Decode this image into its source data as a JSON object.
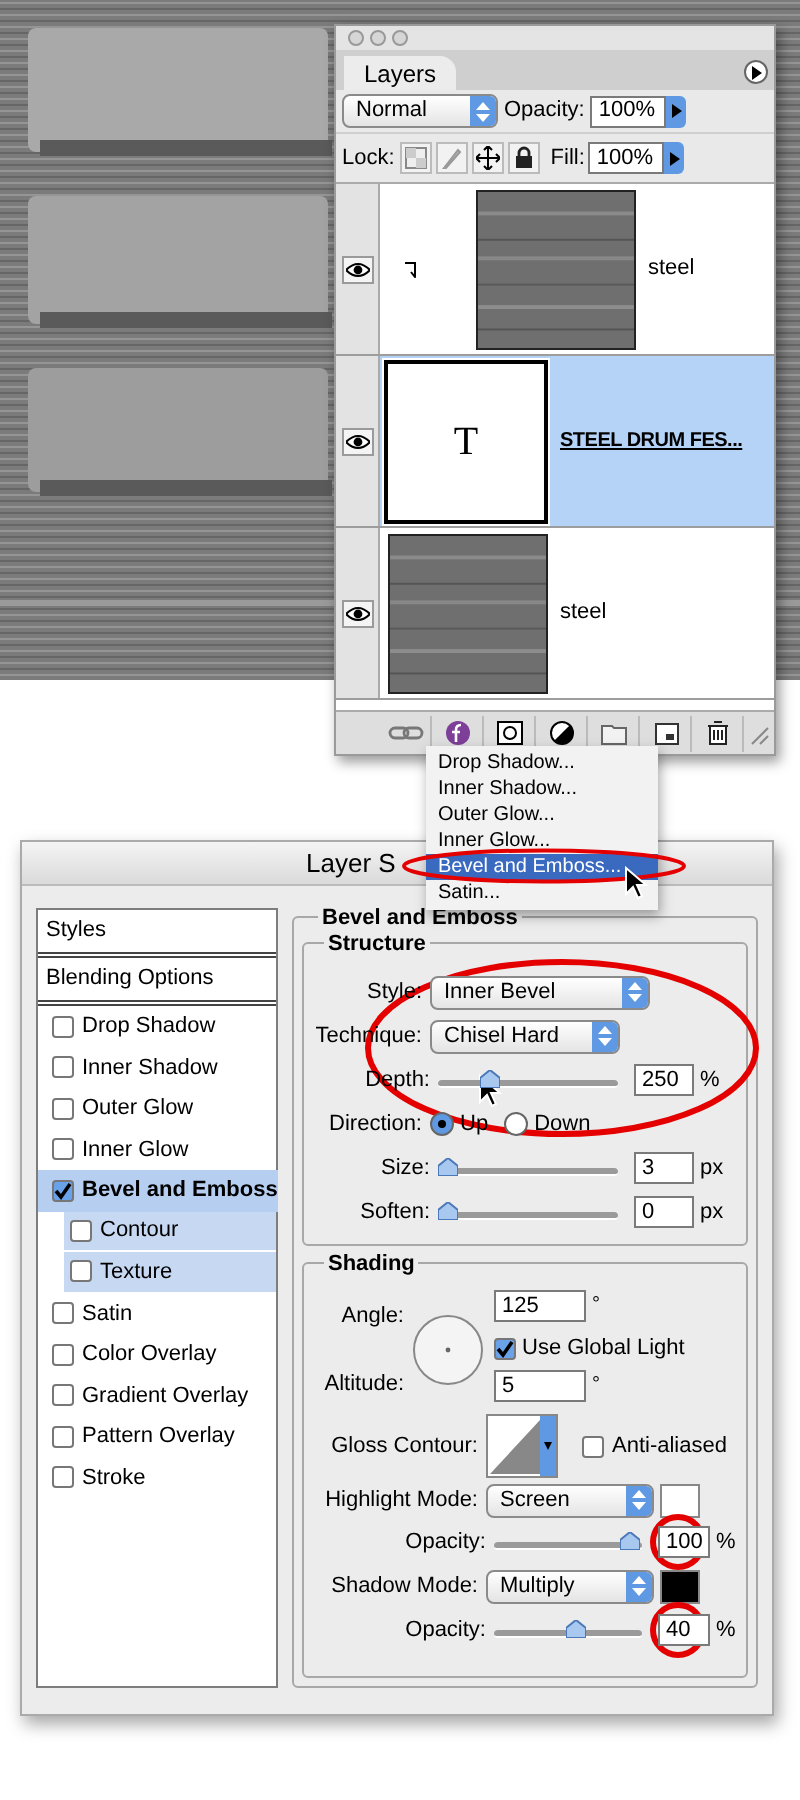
{
  "layers_panel": {
    "tab": "Layers",
    "blend_mode": "Normal",
    "opacity_label": "Opacity:",
    "opacity": "100%",
    "lock_label": "Lock:",
    "fill_label": "Fill:",
    "fill": "100%",
    "layers": [
      {
        "name": "steel",
        "visible": true,
        "clipped": true,
        "selected": false
      },
      {
        "name": "STEEL DRUM FES...",
        "kind": "text",
        "thumb_letter": "T",
        "visible": true,
        "clipped": false,
        "selected": true
      },
      {
        "name": "steel",
        "visible": true,
        "clipped": false,
        "selected": false
      }
    ]
  },
  "effects_menu": {
    "items": [
      {
        "label": "Drop Shadow...",
        "selected": false
      },
      {
        "label": "Inner Shadow...",
        "selected": false
      },
      {
        "label": "Outer Glow...",
        "selected": false
      },
      {
        "label": "Inner Glow...",
        "selected": false
      },
      {
        "label": "Bevel and Emboss...",
        "selected": true
      },
      {
        "label": "Satin...",
        "selected": false
      }
    ]
  },
  "layer_style": {
    "title": "Layer S",
    "styles_list": [
      {
        "label": "Styles",
        "kind": "header"
      },
      {
        "label": "Blending Options",
        "kind": "header"
      },
      {
        "label": "Drop Shadow",
        "kind": "effect",
        "checked": false,
        "selected": false
      },
      {
        "label": "Inner Shadow",
        "kind": "effect",
        "checked": false,
        "selected": false
      },
      {
        "label": "Outer Glow",
        "kind": "effect",
        "checked": false,
        "selected": false
      },
      {
        "label": "Inner Glow",
        "kind": "effect",
        "checked": false,
        "selected": false
      },
      {
        "label": "Bevel and Emboss",
        "kind": "effect",
        "checked": true,
        "selected": true,
        "children": [
          {
            "label": "Contour",
            "kind": "effect",
            "checked": false,
            "selected": true
          },
          {
            "label": "Texture",
            "kind": "effect",
            "checked": false,
            "selected": true
          }
        ]
      },
      {
        "label": "Satin",
        "kind": "effect",
        "checked": false,
        "selected": false
      },
      {
        "label": "Color Overlay",
        "kind": "effect",
        "checked": false,
        "selected": false
      },
      {
        "label": "Gradient Overlay",
        "kind": "effect",
        "checked": false,
        "selected": false
      },
      {
        "label": "Pattern Overlay",
        "kind": "effect",
        "checked": false,
        "selected": false
      },
      {
        "label": "Stroke",
        "kind": "effect",
        "checked": false,
        "selected": false
      }
    ],
    "panel": {
      "title": "Bevel and Emboss",
      "structure": {
        "title": "Structure",
        "style_label": "Style:",
        "style": "Inner Bevel",
        "technique_label": "Technique:",
        "technique": "Chisel Hard",
        "depth": {
          "label": "Depth:",
          "level": 0.26,
          "value": "250",
          "unit": "%"
        },
        "direction": {
          "label": "Direction:",
          "options": [
            {
              "label": "Up",
              "selected": true
            },
            {
              "label": "Down",
              "selected": false
            }
          ]
        },
        "size": {
          "label": "Size:",
          "level": 0,
          "value": "3",
          "unit": "px"
        },
        "soften": {
          "label": "Soften:",
          "level": 0,
          "value": "0",
          "unit": "px"
        }
      },
      "shading": {
        "title": "Shading",
        "angle_label": "Angle:",
        "angle": "125",
        "angle_unit": "°",
        "global_light": {
          "label": "Use Global Light",
          "checked": true
        },
        "altitude_label": "Altitude:",
        "altitude": "5",
        "altitude_unit": "°",
        "gloss_label": "Gloss Contour:",
        "anti_aliased": {
          "label": "Anti-aliased",
          "checked": false
        },
        "highlight": {
          "label": "Highlight Mode:",
          "mode": "Screen",
          "color": "#ffffff"
        },
        "highlight_opacity": {
          "label": "Opacity:",
          "level": 0.98,
          "value": "100",
          "unit": "%"
        },
        "shadow": {
          "label": "Shadow Mode:",
          "mode": "Multiply",
          "color": "#000000"
        },
        "shadow_opacity": {
          "label": "Opacity:",
          "level": 0.57,
          "value": "40",
          "unit": "%"
        }
      }
    }
  }
}
